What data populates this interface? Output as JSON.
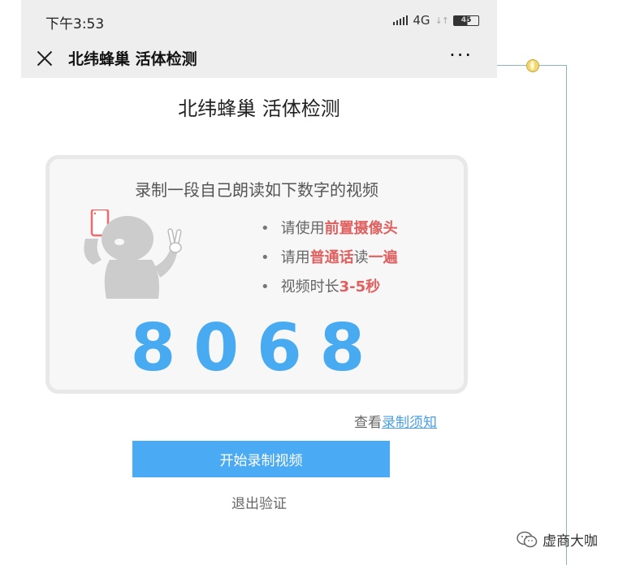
{
  "statusbar": {
    "time": "下午3:53",
    "network": "4G",
    "battery": "45"
  },
  "navbar": {
    "title": "北纬蜂巢 活体检测"
  },
  "page": {
    "title": "北纬蜂巢 活体检测"
  },
  "card": {
    "title": "录制一段自己朗读如下数字的视频",
    "tips": [
      {
        "pre": "请使用",
        "hl1": "前置摄像头",
        "mid": "",
        "hl2": ""
      },
      {
        "pre": "请用",
        "hl1": "普通话",
        "mid": "读",
        "hl2": "一遍"
      },
      {
        "pre": "视频时长",
        "hl1": "3-5秒",
        "mid": "",
        "hl2": ""
      }
    ],
    "code": "8068"
  },
  "notice": {
    "prefix": "查看",
    "link": "录制须知"
  },
  "buttons": {
    "start": "开始录制视频",
    "exit": "退出验证"
  },
  "watermark": {
    "text": "虚商大咖"
  },
  "colors": {
    "accent": "#48aaf0",
    "highlight": "#e06060"
  }
}
